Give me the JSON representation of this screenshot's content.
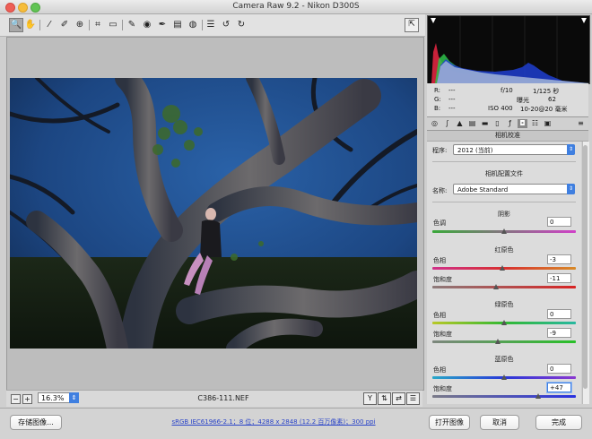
{
  "window": {
    "title": "Camera Raw 9.2  -  Nikon D300S"
  },
  "toolbar": {
    "tools": [
      {
        "name": "zoom-tool",
        "glyph": "🔍"
      },
      {
        "name": "hand-tool",
        "glyph": "✋"
      },
      {
        "name": "white-balance-tool",
        "glyph": "⁄"
      },
      {
        "name": "color-sampler-tool",
        "glyph": "✐"
      },
      {
        "name": "targeted-adjustment-tool",
        "glyph": "⊕"
      },
      {
        "name": "crop-tool",
        "glyph": "⌗"
      },
      {
        "name": "straighten-tool",
        "glyph": "▭"
      },
      {
        "name": "spot-removal-tool",
        "glyph": "✎"
      },
      {
        "name": "red-eye-tool",
        "glyph": "◉"
      },
      {
        "name": "adjustment-brush-tool",
        "glyph": "✒"
      },
      {
        "name": "graduated-filter-tool",
        "glyph": "▤"
      },
      {
        "name": "radial-filter-tool",
        "glyph": "◍"
      },
      {
        "name": "preferences-tool",
        "glyph": "☰"
      },
      {
        "name": "rotate-ccw-tool",
        "glyph": "↺"
      },
      {
        "name": "rotate-cw-tool",
        "glyph": "↻"
      }
    ],
    "fullscreen_glyph": "⇱"
  },
  "preview": {
    "zoom": "16.3%",
    "filename": "C386-111.NEF"
  },
  "readout": {
    "r": "R:",
    "g": "G:",
    "b": "B:",
    "dash": "---",
    "aperture": "f/10",
    "shutter": "1/125 秒",
    "exposure_label": "曝光",
    "exposure_value": "62",
    "iso": "ISO 400",
    "lens": "10-20@20 毫米"
  },
  "panel": {
    "header": "相机校准",
    "process_label": "程序:",
    "process_value": "2012 (当前)",
    "profile_section": "相机配置文件",
    "name_label": "名称:",
    "name_value": "Adobe Standard",
    "shadows": {
      "title": "阴影",
      "tint_label": "色调",
      "tint_value": "0",
      "tint_pos": 0.5
    },
    "red": {
      "title": "红原色",
      "hue_label": "色相",
      "hue_value": "-3",
      "hue_pos": 0.485,
      "sat_label": "饱和度",
      "sat_value": "-11",
      "sat_pos": 0.445
    },
    "green": {
      "title": "绿原色",
      "hue_label": "色相",
      "hue_value": "0",
      "hue_pos": 0.5,
      "sat_label": "饱和度",
      "sat_value": "-9",
      "sat_pos": 0.455
    },
    "blue": {
      "title": "蓝原色",
      "hue_label": "色相",
      "hue_value": "0",
      "hue_pos": 0.5,
      "sat_label": "饱和度",
      "sat_value": "+47",
      "sat_pos": 0.735
    }
  },
  "bottom": {
    "save_label": "存储图像...",
    "workflow_link": "sRGB IEC61966-2.1；8 位；4288 x 2848 (12.2 百万像素)；300 ppi",
    "open_label": "打开图像",
    "cancel_label": "取消",
    "done_label": "完成"
  },
  "colors": {
    "accent": "#3f7fe0",
    "sky": "#1f4a86"
  }
}
